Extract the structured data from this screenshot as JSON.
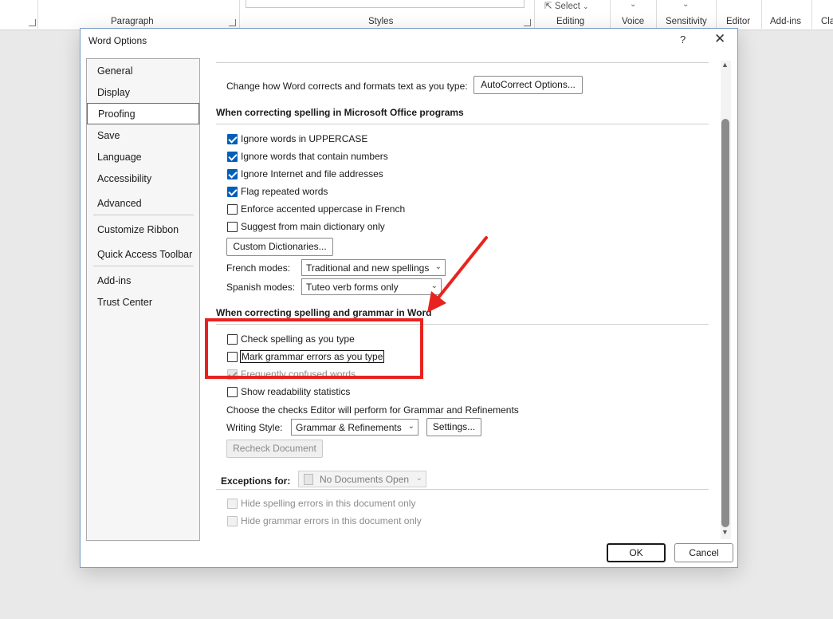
{
  "ribbon": {
    "groups": [
      "Paragraph",
      "Styles",
      "Editing",
      "Voice",
      "Sensitivity",
      "Editor",
      "Add-ins",
      "Cla"
    ],
    "select_label": "Select"
  },
  "dialog": {
    "title": "Word Options",
    "help": "?",
    "close": "✕"
  },
  "nav": {
    "items": [
      "General",
      "Display",
      "Proofing",
      "Save",
      "Language",
      "Accessibility",
      "Advanced",
      "Customize Ribbon",
      "Quick Access Toolbar",
      "Add-ins",
      "Trust Center"
    ],
    "active": "Proofing"
  },
  "autocorrect": {
    "label": "Change how Word corrects and formats text as you type:",
    "button": "AutoCorrect Options..."
  },
  "office_section": {
    "heading": "When correcting spelling in Microsoft Office programs",
    "checkboxes": [
      {
        "label": "Ignore words in UPPERCASE",
        "checked": true
      },
      {
        "label": "Ignore words that contain numbers",
        "checked": true
      },
      {
        "label": "Ignore Internet and file addresses",
        "checked": true
      },
      {
        "label": "Flag repeated words",
        "checked": true
      },
      {
        "label": "Enforce accented uppercase in French",
        "checked": false
      },
      {
        "label": "Suggest from main dictionary only",
        "checked": false
      }
    ],
    "custom_dictionaries_button": "Custom Dictionaries...",
    "french_modes_label": "French modes:",
    "french_modes_value": "Traditional and new spellings",
    "spanish_modes_label": "Spanish modes:",
    "spanish_modes_value": "Tuteo verb forms only"
  },
  "word_section": {
    "heading": "When correcting spelling and grammar in Word",
    "checkboxes": [
      {
        "label": "Check spelling as you type",
        "checked": false
      },
      {
        "label": "Mark grammar errors as you type",
        "checked": false
      },
      {
        "label": "Frequently confused words",
        "checked": true,
        "disabled": true
      },
      {
        "label": "Show readability statistics",
        "checked": false
      }
    ],
    "editor_text": "Choose the checks Editor will perform for Grammar and Refinements",
    "writing_style_label": "Writing Style:",
    "writing_style_value": "Grammar & Refinements",
    "settings_button": "Settings...",
    "recheck_button": "Recheck Document"
  },
  "exceptions": {
    "label": "Exceptions for:",
    "value": "No Documents Open",
    "checkboxes": [
      {
        "label": "Hide spelling errors in this document only",
        "disabled": true
      },
      {
        "label": "Hide grammar errors in this document only",
        "disabled": true
      }
    ]
  },
  "footer": {
    "ok": "OK",
    "cancel": "Cancel"
  },
  "annotation": {
    "color": "#e8231f"
  }
}
